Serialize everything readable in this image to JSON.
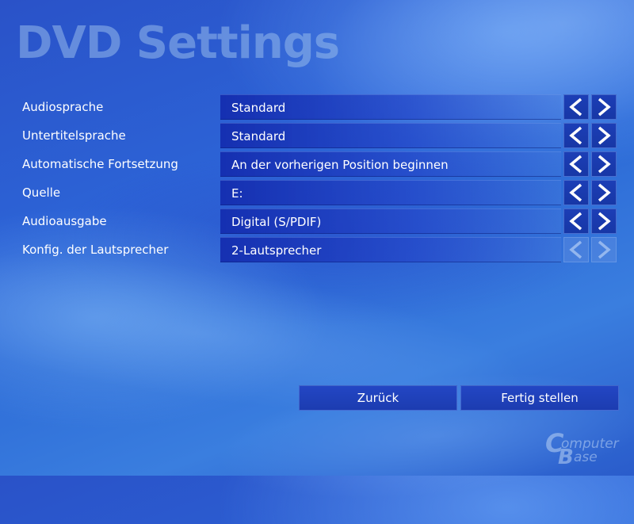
{
  "page": {
    "title": "DVD Settings"
  },
  "settings": [
    {
      "label": "Audiosprache",
      "value": "Standard",
      "arrows_enabled": true
    },
    {
      "label": "Untertitelsprache",
      "value": "Standard",
      "arrows_enabled": true
    },
    {
      "label": "Automatische Fortsetzung",
      "value": "An der vorherigen Position beginnen",
      "arrows_enabled": true
    },
    {
      "label": "Quelle",
      "value": "E:",
      "arrows_enabled": true
    },
    {
      "label": "Audioausgabe",
      "value": "Digital (S/PDIF)",
      "arrows_enabled": true
    },
    {
      "label": "Konfig. der Lautsprecher",
      "value": "2-Lautsprecher",
      "arrows_enabled": false
    }
  ],
  "icons": {
    "previous": "chevron-left-icon",
    "next": "chevron-right-icon"
  },
  "buttons": {
    "back_label": "Zurück",
    "finish_label": "Fertig stellen"
  },
  "watermark": {
    "line1": "omputer",
    "line2": "ase",
    "initial1": "C",
    "initial2": "B"
  },
  "colors": {
    "background": "#2c63d6",
    "value_field": "#1a3caf",
    "button": "#1c3cb0",
    "text": "#ffffff"
  }
}
